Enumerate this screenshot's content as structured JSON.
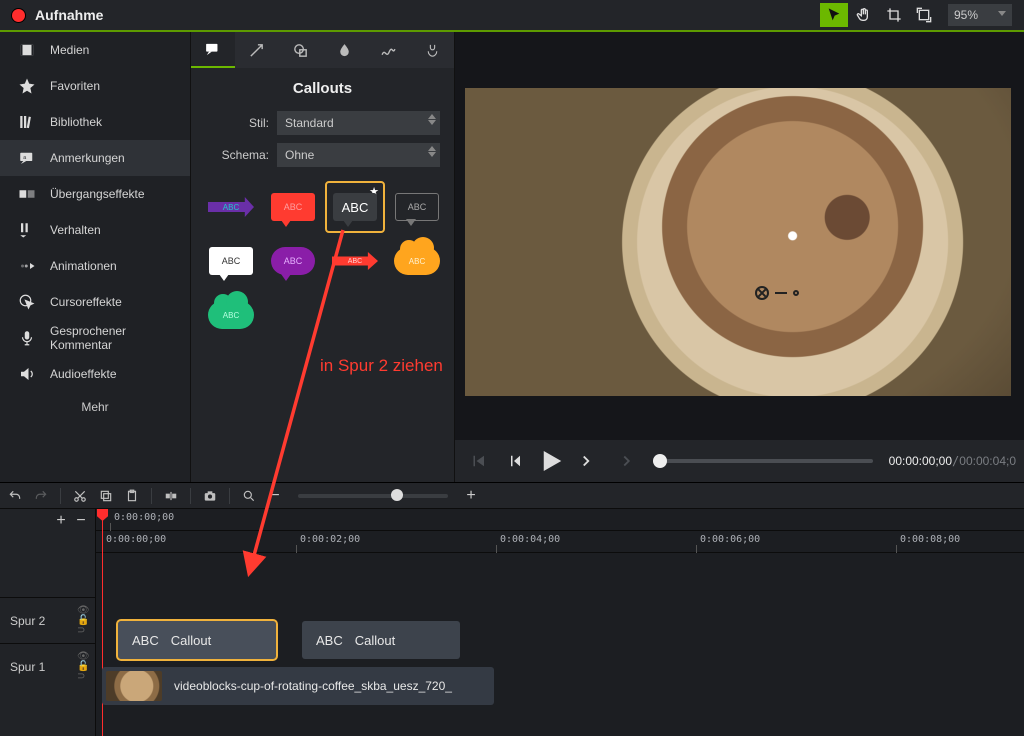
{
  "top": {
    "record_label": "Aufnahme",
    "zoom": "95%"
  },
  "sidebar": {
    "items": [
      {
        "id": "media",
        "label": "Medien"
      },
      {
        "id": "favorites",
        "label": "Favoriten"
      },
      {
        "id": "library",
        "label": "Bibliothek"
      },
      {
        "id": "annotations",
        "label": "Anmerkungen"
      },
      {
        "id": "transitions",
        "label": "Übergangseffekte"
      },
      {
        "id": "behaviors",
        "label": "Verhalten"
      },
      {
        "id": "animations",
        "label": "Animationen"
      },
      {
        "id": "cursorfx",
        "label": "Cursoreffekte"
      },
      {
        "id": "voice",
        "label": "Gesprochener Kommentar"
      },
      {
        "id": "audiofx",
        "label": "Audioeffekte"
      }
    ],
    "active_index": 3,
    "more_label": "Mehr"
  },
  "panel": {
    "title": "Callouts",
    "style_label": "Stil:",
    "style_value": "Standard",
    "scheme_label": "Schema:",
    "scheme_value": "Ohne",
    "thumb_text": "ABC",
    "selected_index": 2
  },
  "annotation_text": "in Spur 2\nziehen",
  "playback": {
    "time_current": "00:00:00;00",
    "time_total": "00:00:04;0"
  },
  "timeline": {
    "ruler_top": [
      "0:00:00;00"
    ],
    "ruler_main": [
      "0:00:00;00",
      "0:00:02;00",
      "0:00:04;00",
      "0:00:06;00",
      "0:00:08;00"
    ],
    "tracks": [
      {
        "name": "Spur 2"
      },
      {
        "name": "Spur 1"
      }
    ],
    "clips": {
      "callout_a": {
        "abc": "ABC",
        "label": "Callout"
      },
      "callout_b": {
        "abc": "ABC",
        "label": "Callout"
      },
      "media": {
        "filename": "videoblocks-cup-of-rotating-coffee_skba_uesz_720_"
      }
    }
  }
}
